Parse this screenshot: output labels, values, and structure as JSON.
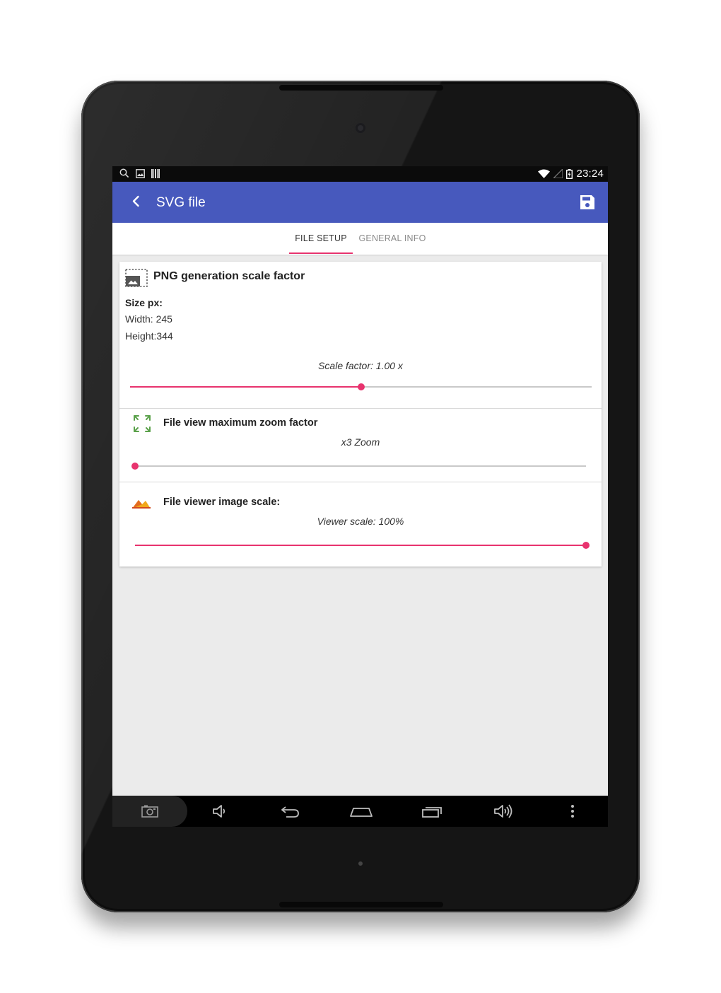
{
  "status_bar": {
    "left_icons": [
      "search-icon",
      "image-icon",
      "barcode-icon"
    ],
    "right_icons": [
      "wifi-icon",
      "signal-icon",
      "battery-charging-icon"
    ],
    "time": "23:24"
  },
  "app_bar": {
    "title": "SVG file",
    "back_icon": "chevron-left-icon",
    "action_icon": "save-icon",
    "color": "#4759bd"
  },
  "tabs": [
    {
      "label": "FILE SETUP",
      "selected": true
    },
    {
      "label": "GENERAL INFO",
      "selected": false
    }
  ],
  "png_section": {
    "title": "PNG generation scale factor",
    "icon": "image-scale-icon",
    "size_label": "Size px:",
    "width_text": "Width: 245",
    "height_text": "Height:344",
    "scale_text": "Scale factor: 1.00 x",
    "slider_fraction": 0.5
  },
  "zoom_section": {
    "title": "File view maximum zoom factor",
    "icon": "expand-arrows-icon",
    "value_text": "x3 Zoom",
    "slider_fraction": 0.0
  },
  "viewer_section": {
    "title": "File viewer image scale:",
    "icon": "mountain-icon",
    "value_text": "Viewer scale: 100%",
    "slider_fraction": 1.0
  },
  "nav_bar": {
    "buttons": [
      "screenshot-icon",
      "volume-down-icon",
      "back-icon",
      "home-icon",
      "recent-apps-icon",
      "volume-up-icon",
      "overflow-menu-icon"
    ]
  },
  "colors": {
    "accent": "#e8336e",
    "primary": "#4759bd",
    "background": "#ebebeb"
  }
}
